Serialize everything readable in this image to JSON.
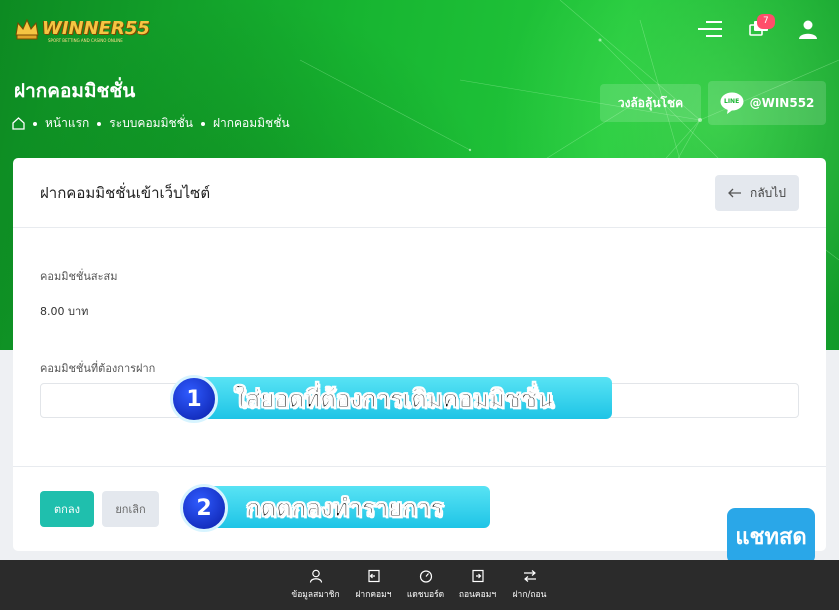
{
  "header": {
    "brand": "WINNER55",
    "brand_tagline": "SPORT BETTING AND CASINO ONLINE",
    "notification_count": "7",
    "page_title": "ฝากคอมมิชชั่น",
    "breadcrumb": [
      "หน้าแรก",
      "ระบบคอมมิชชั่น",
      "ฝากคอมมิชชั่น"
    ],
    "lucky_wheel_label": "วงล้อลุ้นโชค",
    "line_logo_text": "LINE",
    "line_id_label": "@WIN552"
  },
  "card": {
    "title": "ฝากคอมมิชชั่นเข้าเว็บไซต์",
    "back_label": "กลับไป",
    "accumulated_label": "คอมมิชชั่นสะสม",
    "accumulated_value": "8.00 บาท",
    "amount_label": "คอมมิชชั่นที่ต้องการฝาก",
    "amount_value": "",
    "ok_label": "ตกลง",
    "cancel_label": "ยกเลิก"
  },
  "callouts": [
    {
      "number": "1",
      "text": "ใส่ยอดที่ต้องการเติมคอมมิชชั่น"
    },
    {
      "number": "2",
      "text": "กดตกลงทำรายการ"
    }
  ],
  "chat_live_label": "แชทสด",
  "bottom_nav": [
    {
      "label": "ข้อมูลสมาชิก",
      "icon": "user-icon"
    },
    {
      "label": "ฝากคอมฯ",
      "icon": "deposit-icon"
    },
    {
      "label": "แดชบอร์ด",
      "icon": "dashboard-icon"
    },
    {
      "label": "ถอนคอมฯ",
      "icon": "withdraw-icon"
    },
    {
      "label": "ฝาก/ถอน",
      "icon": "transfer-icon"
    }
  ],
  "colors": {
    "hero_green": "#17b531",
    "primary_button": "#1fbfad",
    "callout_cyan": "#1ec4e6",
    "callout_number": "#0a1ea8",
    "badge": "#ff4d6a",
    "chat_live": "#2aa7e8",
    "bottom_nav": "#2b2b2b"
  }
}
